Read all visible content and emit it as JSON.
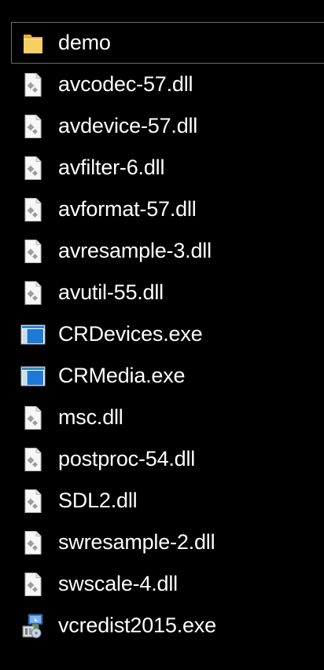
{
  "files": [
    {
      "name": "demo",
      "icon": "folder-icon",
      "type": "folder",
      "selected": true
    },
    {
      "name": "avcodec-57.dll",
      "icon": "dll-file-icon",
      "type": "dll"
    },
    {
      "name": "avdevice-57.dll",
      "icon": "dll-file-icon",
      "type": "dll"
    },
    {
      "name": "avfilter-6.dll",
      "icon": "dll-file-icon",
      "type": "dll"
    },
    {
      "name": "avformat-57.dll",
      "icon": "dll-file-icon",
      "type": "dll"
    },
    {
      "name": "avresample-3.dll",
      "icon": "dll-file-icon",
      "type": "dll"
    },
    {
      "name": "avutil-55.dll",
      "icon": "dll-file-icon",
      "type": "dll"
    },
    {
      "name": "CRDevices.exe",
      "icon": "exe-app-icon",
      "type": "exe"
    },
    {
      "name": "CRMedia.exe",
      "icon": "exe-app-icon",
      "type": "exe"
    },
    {
      "name": "msc.dll",
      "icon": "dll-file-icon",
      "type": "dll"
    },
    {
      "name": "postproc-54.dll",
      "icon": "dll-file-icon",
      "type": "dll"
    },
    {
      "name": "SDL2.dll",
      "icon": "dll-file-icon",
      "type": "dll"
    },
    {
      "name": "swresample-2.dll",
      "icon": "dll-file-icon",
      "type": "dll"
    },
    {
      "name": "swscale-4.dll",
      "icon": "dll-file-icon",
      "type": "dll"
    },
    {
      "name": "vcredist2015.exe",
      "icon": "installer-icon",
      "type": "installer"
    }
  ],
  "colors": {
    "background": "#000000",
    "text": "#ffffff",
    "selection_border": "#6b6b6b",
    "folder": "#f4c55c",
    "exe_accent": "#1e7fd8"
  }
}
